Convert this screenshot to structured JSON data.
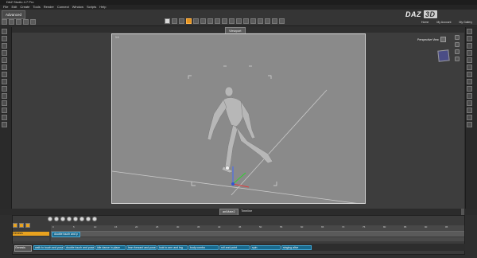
{
  "app": {
    "title": "DAZ Studio 4.7 Pro"
  },
  "menu": {
    "items": [
      "File",
      "Edit",
      "Create",
      "Tools",
      "Render",
      "Connect",
      "Window",
      "Scripts",
      "Help"
    ]
  },
  "toolbar": {
    "mode_tab": "Advanced"
  },
  "brand": {
    "logo_text": "DAZ",
    "logo_3d": "3D"
  },
  "top_links": [
    "Home",
    "My Account",
    "My Gallery"
  ],
  "viewport": {
    "tab_label": "Viewport",
    "camera_label": "Perspective View",
    "corner_label": "1:1"
  },
  "timeline": {
    "tab_aniMate": "aniMate2",
    "tab_timeline": "Timeline",
    "layer_label": "Genesis",
    "block_label": "double touch and p",
    "ruler_ticks": [
      "0",
      "5",
      "10",
      "15",
      "20",
      "25",
      "30",
      "35",
      "40",
      "45",
      "50",
      "55",
      "60",
      "65",
      "70",
      "75",
      "80",
      "85",
      "90",
      "95",
      "100"
    ],
    "preset_dropdown": "Genesis",
    "clips": [
      "walk to touch and pose",
      "double touch and pose",
      "idle dance in place",
      "lean forward and pose",
      "look to arm and leg",
      "body combo",
      "roll and point",
      "spin",
      "singing alive"
    ]
  },
  "colors": {
    "accent": "#e8a21f",
    "clip_blue": "#1a6a8d",
    "viewport_bg": "#8a8a8a"
  }
}
